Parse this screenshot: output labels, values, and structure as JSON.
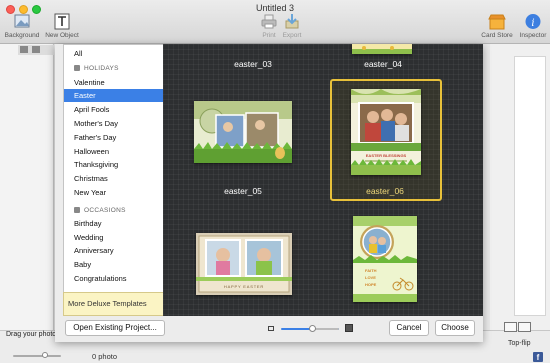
{
  "window": {
    "title": "Untitled 3"
  },
  "toolbar": {
    "background_label": "Background",
    "new_object_label": "New Object",
    "print_label": "Print",
    "export_label": "Export",
    "card_store_label": "Card Store",
    "inspector_label": "Inspector"
  },
  "categories": {
    "all_label": "All",
    "holidays_header": "HOLIDAYS",
    "holidays": [
      "Valentine",
      "Easter",
      "April Fools",
      "Mother's Day",
      "Father's Day",
      "Halloween",
      "Thanksgiving",
      "Christmas",
      "New Year"
    ],
    "selected": "Easter",
    "occasions_header": "OCCASIONS",
    "occasions": [
      "Birthday",
      "Wedding",
      "Anniversary",
      "Baby",
      "Congratulations"
    ],
    "more_label": "More Deluxe Templates"
  },
  "templates": {
    "items": [
      "easter_03",
      "easter_04",
      "easter_05",
      "easter_06"
    ],
    "selected": "easter_06",
    "card_text": {
      "easter_06": "EASTER BLESSINGS",
      "happy": "HAPPY EASTER",
      "faith": "FAITH",
      "love": "LOVE",
      "hope": "HOPE"
    }
  },
  "sheet": {
    "open_existing_label": "Open Existing Project...",
    "cancel_label": "Cancel",
    "choose_label": "Choose"
  },
  "status": {
    "drag_hint": "Drag your photos h",
    "photo_count": "0 photo",
    "topflip_label": "Top-flip"
  },
  "colors": {
    "accent": "#3b80e6",
    "selection": "#e8c13a",
    "gallery_bg": "#2d2f31"
  }
}
